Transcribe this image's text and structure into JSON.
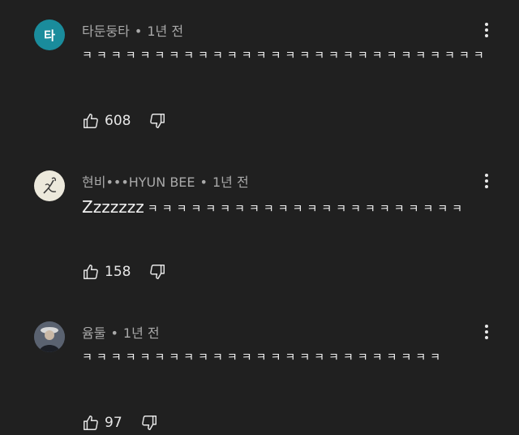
{
  "comments": [
    {
      "avatar": {
        "letter": "타",
        "color": "#1a8c9c"
      },
      "author": "타둔둥타",
      "bullet": "•",
      "time": "1년 전",
      "text_lead": "",
      "text": "ㅋㅋㅋㅋㅋㅋㅋㅋㅋㅋㅋㅋㅋㅋㅋㅋㅋㅋㅋㅋㅋㅋㅋㅋㅋㅋㅋㅋ",
      "likes": "608"
    },
    {
      "avatar": {
        "letter": "",
        "color": "#ece9dc"
      },
      "author": "현비•••HYUN BEE",
      "bullet": "•",
      "time": "1년 전",
      "text_lead": "Zzzzzzz",
      "text": "ㅋㅋㅋㅋㅋㅋㅋㅋㅋㅋㅋㅋㅋㅋㅋㅋㅋㅋㅋㅋㅋㅋ",
      "likes": "158"
    },
    {
      "avatar": {
        "letter": "",
        "color": "#3a4250"
      },
      "author": "윰둘",
      "bullet": "•",
      "time": "1년 전",
      "text_lead": "",
      "text": "ㅋㅋㅋㅋㅋㅋㅋㅋㅋㅋㅋㅋㅋㅋㅋㅋㅋㅋㅋㅋㅋㅋㅋㅋㅋ",
      "likes": "97"
    }
  ],
  "icons": {
    "like": "thumbs-up-icon",
    "dislike": "thumbs-down-icon",
    "menu": "more-vert-icon"
  }
}
